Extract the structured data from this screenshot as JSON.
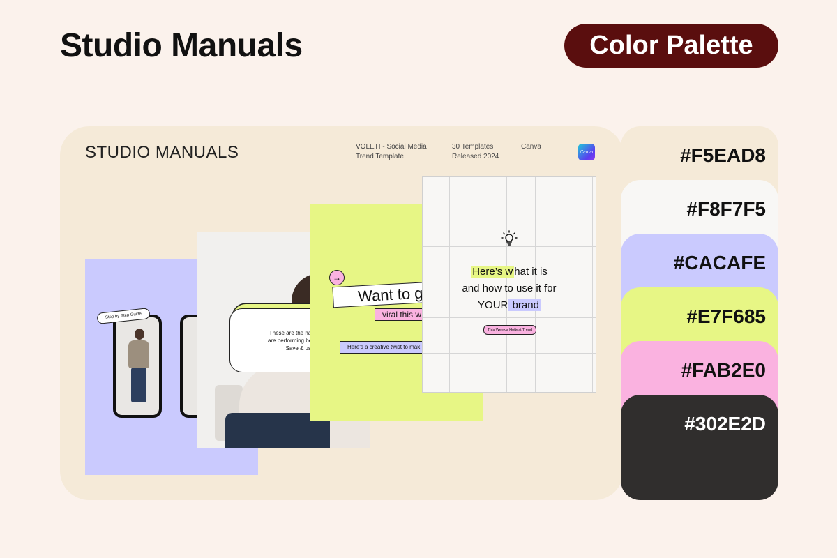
{
  "header": {
    "title": "Studio Manuals",
    "badge": "Color Palette"
  },
  "preview": {
    "brand": "STUDIO MANUALS",
    "meta": [
      {
        "line1": "VOLETI - Social Media",
        "line2": "Trend Template"
      },
      {
        "line1": "30 Templates",
        "line2": "Released 2024"
      },
      {
        "line1": "Canva",
        "line2": ""
      }
    ],
    "canva_logo": "Canva",
    "cards": {
      "phone_guide": "Step by Step Guide",
      "hashtag_lines": [
        "These are the hashtags t",
        "are performing best this w",
        "Save & use"
      ],
      "want": "Want to g",
      "viral": "viral this w",
      "creative": "Here's a creative twist to mak",
      "grid_line1_hl": "Here’s w",
      "grid_line1_rest": "hat it is",
      "grid_line2": "and how to use it for",
      "grid_line3_a": "YOUR",
      "grid_line3_hl": " brand",
      "hottest": "This Week's Hottest Trend"
    }
  },
  "palette": [
    {
      "hex": "#F5EAD8",
      "color": "#f5ead8",
      "text_color": "#111111"
    },
    {
      "hex": "#F8F7F5",
      "color": "#f8f7f5",
      "text_color": "#111111"
    },
    {
      "hex": "#CACAFE",
      "color": "#cacafe",
      "text_color": "#111111"
    },
    {
      "hex": "#E7F685",
      "color": "#e7f685",
      "text_color": "#111111"
    },
    {
      "hex": "#FAB2E0",
      "color": "#fab2e0",
      "text_color": "#111111"
    },
    {
      "hex": "#302E2D",
      "color": "#302e2d",
      "text_color": "#ffffff"
    }
  ],
  "icons": [
    "arrow-right-icon",
    "lightbulb-icon",
    "canva-logo-icon"
  ]
}
